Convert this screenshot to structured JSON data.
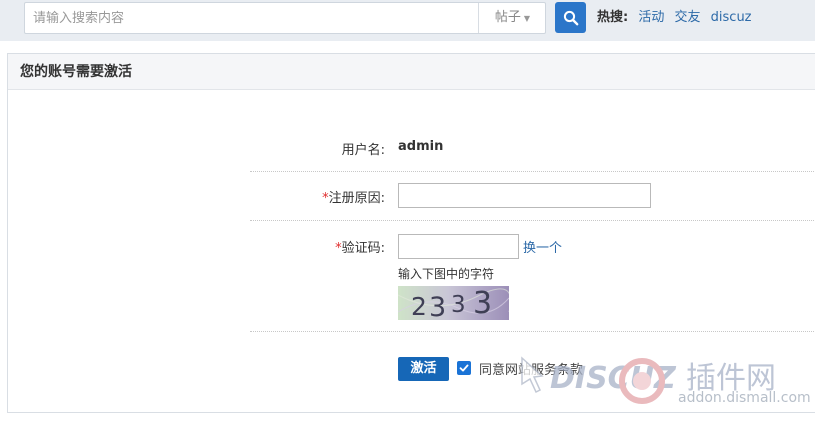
{
  "search": {
    "placeholder": "请输入搜索内容",
    "type_label": "帖子",
    "hot_label": "热搜:",
    "hot_links": [
      "活动",
      "交友",
      "discuz"
    ]
  },
  "panel": {
    "title": "您的账号需要激活"
  },
  "form": {
    "username_label": "用户名:",
    "username_value": "admin",
    "reason_required_mark": "*",
    "reason_label": "注册原因:",
    "reason_value": "",
    "captcha_required_mark": "*",
    "captcha_label": "验证码:",
    "captcha_value": "",
    "captcha_refresh": "换一个",
    "captcha_hint": "输入下图中的字符",
    "captcha_image_text": "2333",
    "submit_label": "激活",
    "agree_checked": true,
    "agree_label": "同意网站服务条款"
  },
  "watermark": {
    "brand": "DISCUZ",
    "cn_text": "插件网",
    "url": "addon.dismall.com"
  },
  "colors": {
    "primary": "#1667b7",
    "link": "#2d6aa8",
    "required": "#e02d2d"
  }
}
